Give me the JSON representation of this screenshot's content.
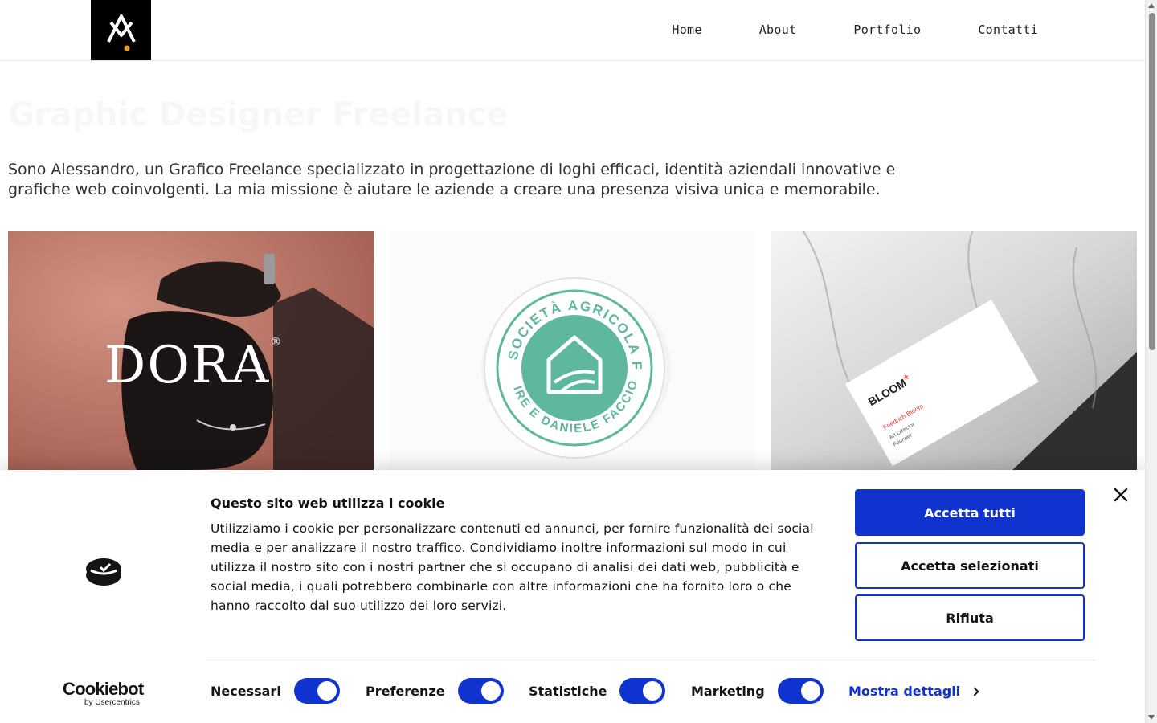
{
  "nav": {
    "items": [
      {
        "label": "Home"
      },
      {
        "label": "About"
      },
      {
        "label": "Portfolio"
      },
      {
        "label": "Contatti"
      }
    ]
  },
  "hero": {
    "title": "Graphic Designer Freelance",
    "intro": "Sono Alessandro, un Grafico Freelance specializzato in progettazione di loghi efficaci, identità aziendali innovative e grafiche web coinvolgenti. La mia missione è aiutare le aziende a creare una presenza visiva unica e memorabile."
  },
  "portfolio": {
    "tiles": [
      {
        "brand": "DORA",
        "reg": "®"
      },
      {
        "ring_text": "SOCIETÀ AGRICOLA FACCIO",
        "ring_bottom": "IRE E DANIELE FACCIO"
      },
      {
        "brand": "BLOOM",
        "name": "Friedrich Bloom",
        "role": "Art Director",
        "note": "Founder"
      }
    ]
  },
  "cookie": {
    "title": "Questo sito web utilizza i cookie",
    "text": "Utilizziamo i cookie per personalizzare contenuti ed annunci, per fornire funzionalità dei social media e per analizzare il nostro traffico. Condividiamo inoltre informazioni sul modo in cui utilizza il nostro sito con i nostri partner che si occupano di analisi dei dati web, pubblicità e social media, i quali potrebbero combinarle con altre informazioni che ha fornito loro o che hanno raccolto dal suo utilizzo dei loro servizi.",
    "accept_all": "Accetta tutti",
    "accept_selected": "Accetta selezionati",
    "reject": "Rifiuta",
    "provider_name": "Cookiebot",
    "provider_by": "by Usercentrics",
    "categories": [
      {
        "label": "Necessari",
        "checked": true
      },
      {
        "label": "Preferenze",
        "checked": true
      },
      {
        "label": "Statistiche",
        "checked": true
      },
      {
        "label": "Marketing",
        "checked": true
      }
    ],
    "details_label": "Mostra dettagli"
  },
  "colors": {
    "accent": "#1032cf",
    "logo_dot": "#f39a1c",
    "seal_green": "#5db89d"
  },
  "icons": {
    "close": "close-icon",
    "chevron": "chevron-right-icon"
  }
}
